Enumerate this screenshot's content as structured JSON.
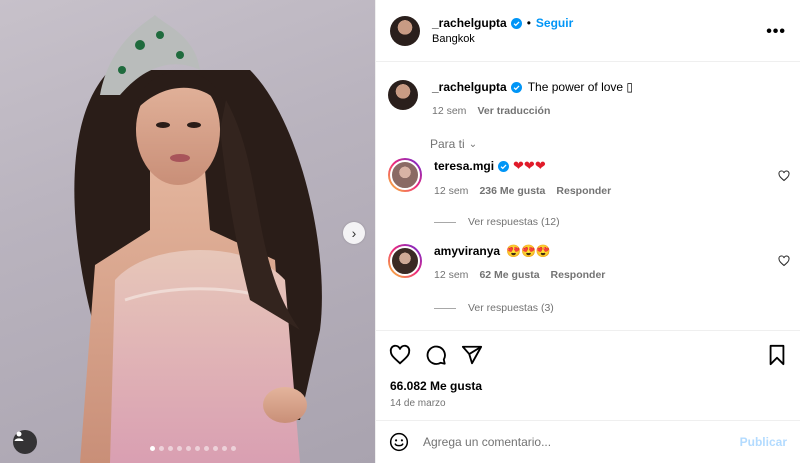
{
  "post": {
    "username": "_rachelgupta",
    "separator": "•",
    "follow_label": "Seguir",
    "location": "Bangkok",
    "more_label": "•••"
  },
  "caption": {
    "username": "_rachelgupta",
    "text": "The power of love ▯",
    "time": "12 sem",
    "translate_label": "Ver traducción"
  },
  "sort": {
    "label": "Para ti",
    "chevron": "⌄"
  },
  "comments": [
    {
      "username": "teresa.mgi",
      "text": "❤❤❤",
      "time": "12 sem",
      "likes": "236 Me gusta",
      "reply_label": "Responder",
      "view_replies": "Ver respuestas (12)"
    },
    {
      "username": "amyviranya",
      "text": "😍😍😍",
      "time": "12 sem",
      "likes": "62 Me gusta",
      "reply_label": "Responder",
      "view_replies": "Ver respuestas (3)"
    }
  ],
  "stats": {
    "likes": "66.082 Me gusta",
    "date": "14 de marzo"
  },
  "add_comment": {
    "placeholder": "Agrega un comentario...",
    "publish_label": "Publicar"
  },
  "media": {
    "next_label": "›",
    "slide_count": 10,
    "active_slide": 0
  },
  "colors": {
    "accent": "#0095f6",
    "muted": "#737373",
    "publish_disabled": "#b3dbff",
    "verified": "#0095f6"
  },
  "icons": [
    "more-icon",
    "verified-icon",
    "heart-icon",
    "comment-icon",
    "share-icon",
    "bookmark-icon",
    "smile-icon",
    "user-tag-icon",
    "chevron-right-icon",
    "chevron-down-icon"
  ]
}
